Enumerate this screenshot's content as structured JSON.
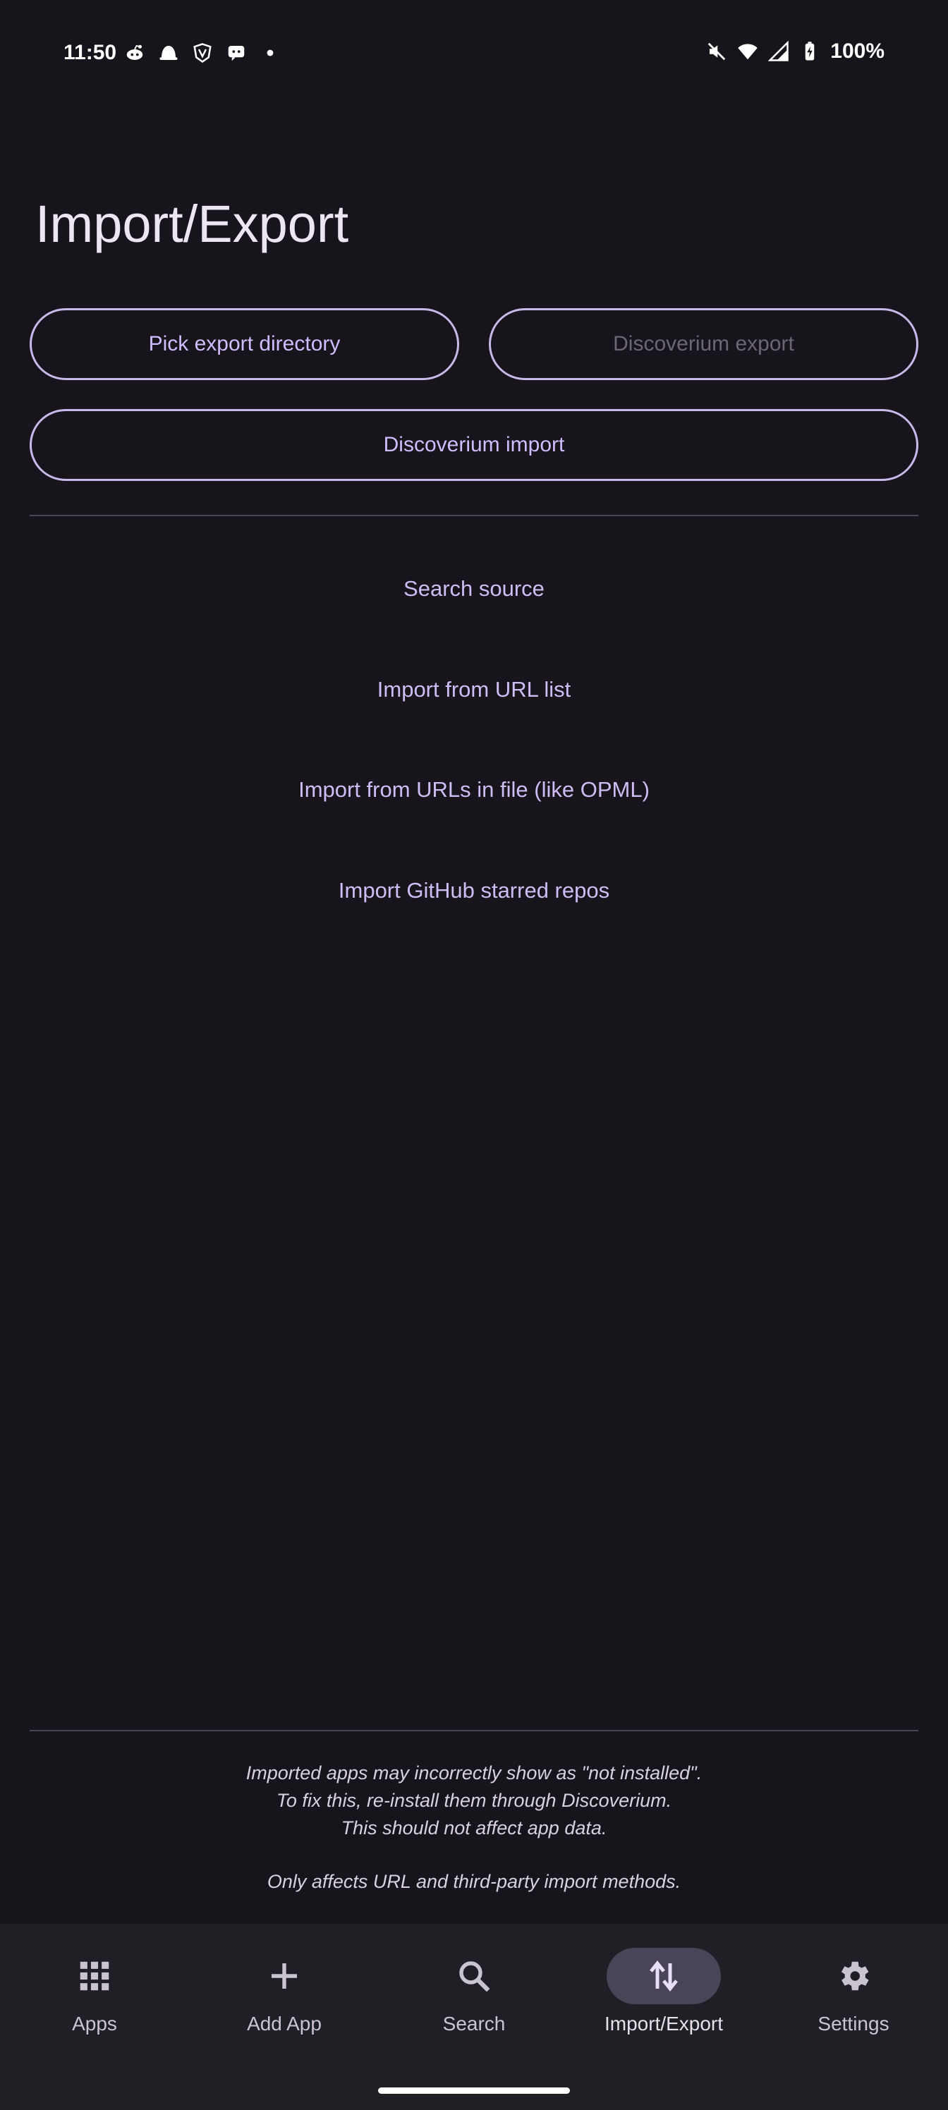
{
  "status_bar": {
    "time": "11:50",
    "left_icons": [
      "reddit-icon",
      "ghost-icon",
      "vpn-shield-icon",
      "messaging-icon",
      "dot-icon"
    ],
    "right_icons": [
      "mute-icon",
      "wifi-icon",
      "cell-signal-icon",
      "battery-charging-icon"
    ],
    "battery": "100%"
  },
  "page": {
    "title": "Import/Export"
  },
  "buttons": {
    "pick_export_directory": "Pick export directory",
    "discoverium_export": "Discoverium export",
    "discoverium_import": "Discoverium import"
  },
  "actions": [
    "Search source",
    "Import from URL list",
    "Import from URLs in file (like OPML)",
    "Import GitHub starred repos"
  ],
  "footnote": {
    "line1": "Imported apps may incorrectly show as \"not installed\".",
    "line2": "To fix this, re-install them through Discoverium.",
    "line3": "This should not affect app data.",
    "line4": "Only affects URL and third-party import methods."
  },
  "nav": {
    "items": [
      {
        "label": "Apps",
        "icon": "apps-grid-icon"
      },
      {
        "label": "Add App",
        "icon": "plus-icon"
      },
      {
        "label": "Search",
        "icon": "search-icon"
      },
      {
        "label": "Import/Export",
        "icon": "import-export-icon",
        "active": true
      },
      {
        "label": "Settings",
        "icon": "gear-icon"
      }
    ]
  },
  "colors": {
    "background": "#17151b",
    "accent": "#d0bcff",
    "outline": "#c9b9ea",
    "nav_background": "#211f26",
    "nav_active_pill": "#4a4458"
  }
}
